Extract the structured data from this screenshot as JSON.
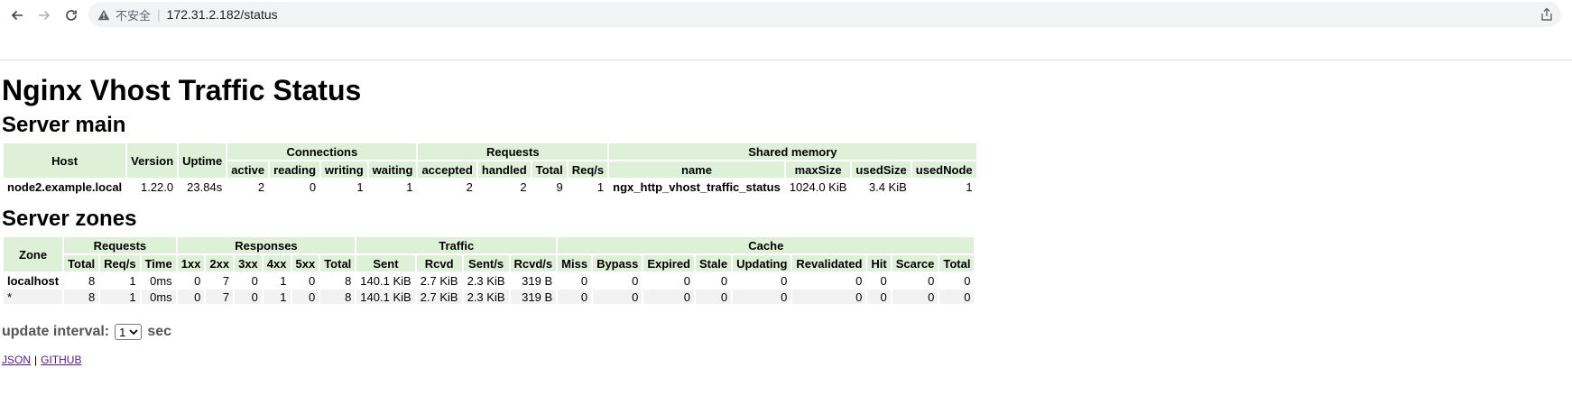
{
  "browser": {
    "insecure_label": "不安全",
    "url": "172.31.2.182/status"
  },
  "page": {
    "title": "Nginx Vhost Traffic Status",
    "server_main": {
      "heading": "Server main",
      "group_headers": [
        "Connections",
        "Requests",
        "Shared memory"
      ],
      "headers": {
        "host": "Host",
        "version": "Version",
        "uptime": "Uptime",
        "connections": [
          "active",
          "reading",
          "writing",
          "waiting"
        ],
        "requests": [
          "accepted",
          "handled",
          "Total",
          "Req/s"
        ],
        "shared": [
          "name",
          "maxSize",
          "usedSize",
          "usedNode"
        ]
      },
      "row": [
        "node2.example.local",
        "1.22.0",
        "23.84s",
        "2",
        "0",
        "1",
        "1",
        "2",
        "2",
        "9",
        "1",
        "ngx_http_vhost_traffic_status",
        "1024.0 KiB",
        "3.4 KiB",
        "1"
      ]
    },
    "server_zones": {
      "heading": "Server zones",
      "zone_header": "Zone",
      "group_headers": [
        "Requests",
        "Responses",
        "Traffic",
        "Cache"
      ],
      "headers": {
        "requests": [
          "Total",
          "Req/s",
          "Time"
        ],
        "responses": [
          "1xx",
          "2xx",
          "3xx",
          "4xx",
          "5xx",
          "Total"
        ],
        "traffic": [
          "Sent",
          "Rcvd",
          "Sent/s",
          "Rcvd/s"
        ],
        "cache": [
          "Miss",
          "Bypass",
          "Expired",
          "Stale",
          "Updating",
          "Revalidated",
          "Hit",
          "Scarce",
          "Total"
        ]
      },
      "rows": [
        [
          "localhost",
          "8",
          "1",
          "0ms",
          "0",
          "7",
          "0",
          "1",
          "0",
          "8",
          "140.1 KiB",
          "2.7 KiB",
          "2.3 KiB",
          "319 B",
          "0",
          "0",
          "0",
          "0",
          "0",
          "0",
          "0",
          "0",
          "0"
        ],
        [
          "*",
          "8",
          "1",
          "0ms",
          "0",
          "7",
          "0",
          "1",
          "0",
          "8",
          "140.1 KiB",
          "2.7 KiB",
          "2.3 KiB",
          "319 B",
          "0",
          "0",
          "0",
          "0",
          "0",
          "0",
          "0",
          "0",
          "0"
        ]
      ]
    },
    "update_interval": {
      "label": "update interval:",
      "value": "1",
      "unit": "sec"
    },
    "links": {
      "json": "JSON",
      "separator": "|",
      "github": "GITHUB"
    }
  }
}
